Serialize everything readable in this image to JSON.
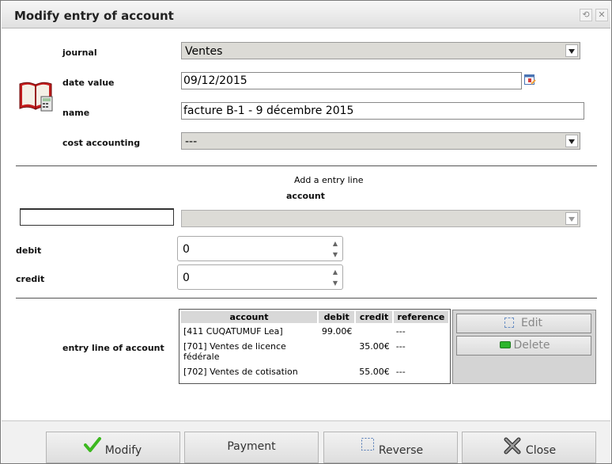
{
  "window": {
    "title": "Modify entry of account"
  },
  "form": {
    "journal_label": "journal",
    "journal_value": "Ventes",
    "date_label": "date value",
    "date_value": "09/12/2015",
    "name_label": "name",
    "name_value": "facture B-1 - 9 décembre 2015",
    "cost_label": "cost accounting",
    "cost_value": "---"
  },
  "entry": {
    "section_title": "Add a entry line",
    "account_label": "account",
    "account_code_value": "",
    "account_select_value": "",
    "debit_label": "debit",
    "debit_value": "0",
    "credit_label": "credit",
    "credit_value": "0"
  },
  "lines": {
    "label": "entry line of account",
    "headers": [
      "account",
      "debit",
      "credit",
      "reference"
    ],
    "rows": [
      {
        "account": "[411 CUQATUMUF Lea]",
        "debit": "99.00€",
        "credit": "",
        "reference": "---"
      },
      {
        "account": "[701] Ventes de licence fédérale",
        "debit": "",
        "credit": "35.00€",
        "reference": "---"
      },
      {
        "account": "[702] Ventes de cotisation",
        "debit": "",
        "credit": "55.00€",
        "reference": "---"
      }
    ],
    "edit_label": "Edit",
    "delete_label": "Delete"
  },
  "footer": {
    "modify_label": "Modify",
    "payment_label": "Payment",
    "reverse_label": "Reverse",
    "close_label": "Close"
  },
  "icons": {
    "book": "book-calculator-icon",
    "calendar": "calendar-icon",
    "modify": "checkmark-icon",
    "reverse": "reverse-icon",
    "close": "close-x-icon"
  },
  "colors": {
    "check_green": "#3cb81f",
    "delete_green": "#2db52d"
  }
}
